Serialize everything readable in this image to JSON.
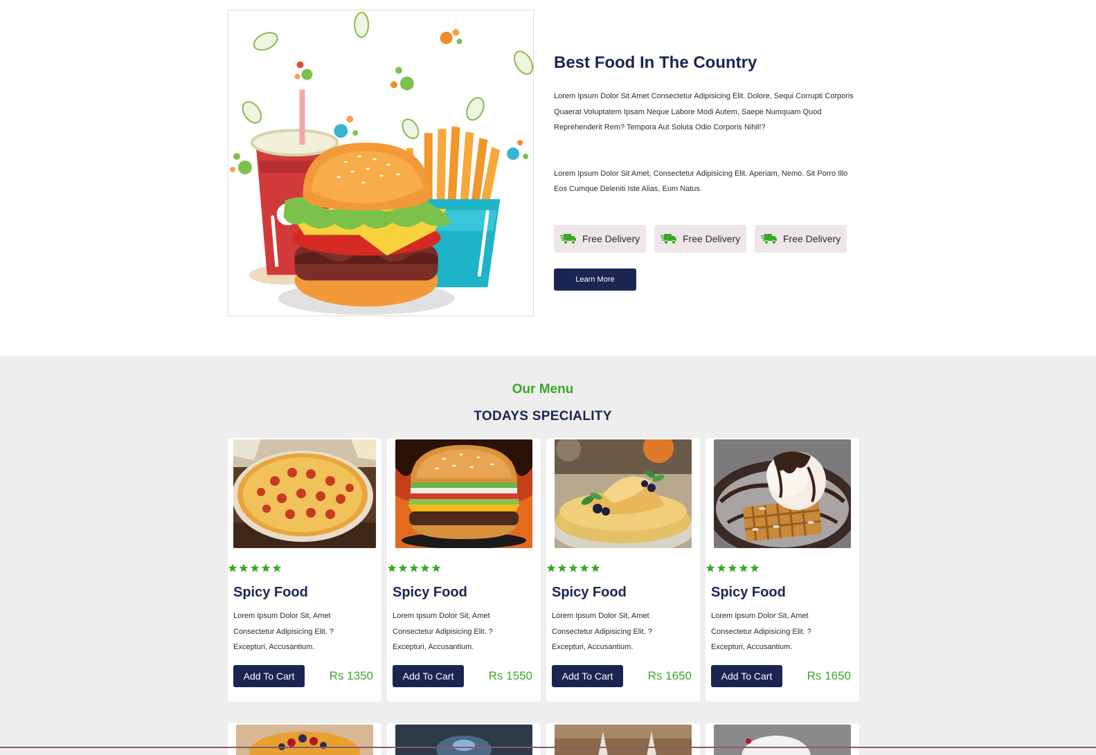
{
  "about": {
    "title": "Best Food In The Country",
    "paragraph1": "Lorem Ipsum Dolor Sit Amet Consectetur Adipisicing Elit. Dolore, Sequi Corrupti Corporis Quaerat Voluptatem Ipsam Neque Labore Modi Autem, Saepe Numquam Quod Reprehenderit Rem? Tempora Aut Soluta Odio Corporis Nihil!?",
    "paragraph2": "Lorem Ipsum Dolor Sit Amet, Consectetur Adipisicing Elit. Aperiam, Nemo. Sit Porro Illo Eos Cumque Deleniti Iste Alias, Eum Natus.",
    "features": [
      {
        "label": "Free Delivery",
        "icon": "delivery-truck-icon"
      },
      {
        "label": "Free Delivery",
        "icon": "delivery-truck-icon"
      },
      {
        "label": "Free Delivery",
        "icon": "delivery-truck-icon"
      }
    ],
    "learn_more_label": "Learn More"
  },
  "menu": {
    "subtitle": "Our Menu",
    "title": "TODAYS SPECIALITY",
    "items": [
      {
        "image": "pizza",
        "title": "Spicy Food",
        "description": "Lorem Ipsum Dolor Sit, Amet Consectetur Adipisicing Elit. ?Excepturi, Accusantium.",
        "button": "Add To Cart",
        "price": "Rs 1350",
        "rating": 5
      },
      {
        "image": "burger",
        "title": "Spicy Food",
        "description": "Lorem Ipsum Dolor Sit, Amet Consectetur Adipisicing Elit. ?Excepturi, Accusantium.",
        "button": "Add To Cart",
        "price": "Rs 1550",
        "rating": 5
      },
      {
        "image": "crepes",
        "title": "Spicy Food",
        "description": "Lorem Ipsum Dolor Sit, Amet Consectetur Adipisicing Elit. ?Excepturi, Accusantium.",
        "button": "Add To Cart",
        "price": "Rs 1650",
        "rating": 5
      },
      {
        "image": "waffle-ice-cream",
        "title": "Spicy Food",
        "description": "Lorem Ipsum Dolor Sit, Amet Consectetur Adipisicing Elit. ?Excepturi, Accusantium.",
        "button": "Add To Cart",
        "price": "Rs 1650",
        "rating": 5
      }
    ]
  },
  "colors": {
    "navy": "#1b2552",
    "green": "#3aa827",
    "menu_background": "#eeeeee",
    "feature_background": "#efe7e7"
  }
}
